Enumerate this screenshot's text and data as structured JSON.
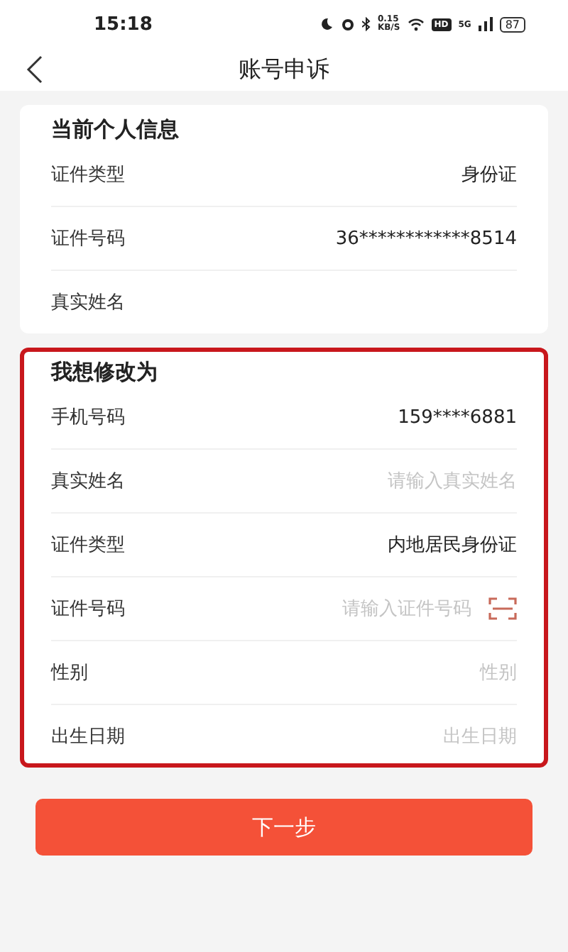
{
  "status_bar": {
    "time": "15:18",
    "speed": "0.15",
    "speed_unit": "KB/S",
    "hd": "HD",
    "network": "5G",
    "battery": "87"
  },
  "header": {
    "title": "账号申诉"
  },
  "current_info": {
    "title": "当前个人信息",
    "rows": [
      {
        "label": "证件类型",
        "value": "身份证"
      },
      {
        "label": "证件号码",
        "value": "36************8514"
      },
      {
        "label": "真实姓名"
      }
    ]
  },
  "change_to": {
    "title": "我想修改为",
    "highlighted": true,
    "rows": [
      {
        "kind": "text",
        "label": "手机号码",
        "value": "159****6881"
      },
      {
        "kind": "input",
        "label": "真实姓名",
        "placeholder": "请输入真实姓名"
      },
      {
        "kind": "text",
        "label": "证件类型",
        "value": "内地居民身份证"
      },
      {
        "kind": "scan",
        "label": "证件号码",
        "placeholder": "请输入证件号码"
      },
      {
        "kind": "picker",
        "label": "性别",
        "placeholder": "性别"
      },
      {
        "kind": "picker",
        "label": "出生日期",
        "placeholder": "出生日期"
      }
    ]
  },
  "next_button": {
    "label": "下一步"
  }
}
